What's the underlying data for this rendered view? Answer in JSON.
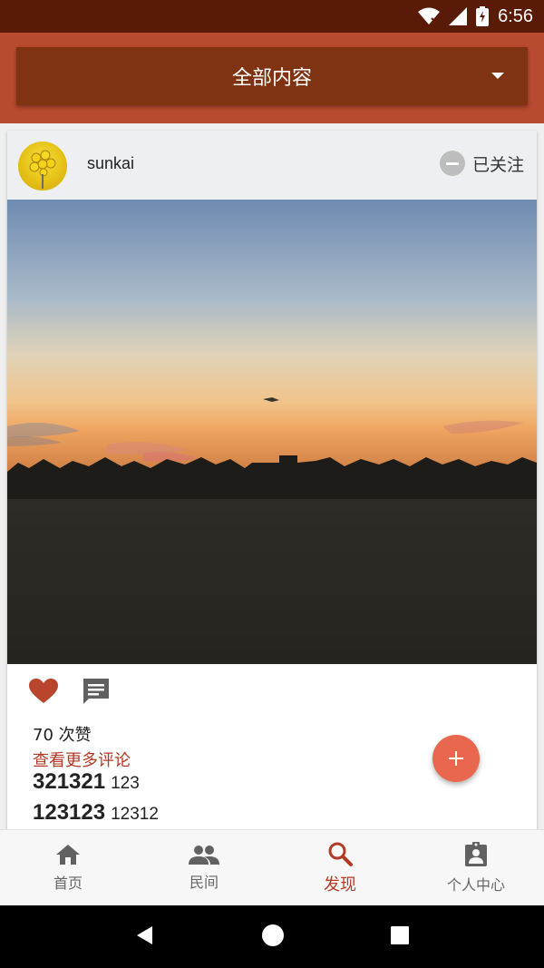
{
  "status_bar": {
    "time": "6:56",
    "icons": [
      "wifi-icon",
      "cell-signal-icon",
      "battery-icon"
    ]
  },
  "header": {
    "dropdown_label": "全部内容",
    "caret_icon": "dropdown-caret-icon"
  },
  "post": {
    "username": "sunkai",
    "avatar_icon": "avatar",
    "follow_label": "已关注",
    "follow_icon": "minus-circle-icon",
    "likes_text": "70 次赞",
    "more_comments_label": "查看更多评论",
    "comments": [
      {
        "author": "321321",
        "text": "123"
      },
      {
        "author": "123123",
        "text": "12312"
      }
    ],
    "liked": true
  },
  "fab": {
    "icon": "add-icon",
    "label": "+"
  },
  "bottom_nav": {
    "items": [
      {
        "label": "首页",
        "icon": "home-icon",
        "active": false
      },
      {
        "label": "民间",
        "icon": "people-icon",
        "active": false
      },
      {
        "label": "发现",
        "icon": "search-icon",
        "active": true
      },
      {
        "label": "个人中心",
        "icon": "profile-icon",
        "active": false
      }
    ]
  },
  "system_nav": {
    "icons": [
      "back-icon",
      "home-circle-icon",
      "recents-icon"
    ]
  },
  "colors": {
    "primary": "#b84a2f",
    "primary_dark": "#5a1a08",
    "dropdown_bg": "#7f3312",
    "accent": "#b23a26",
    "fab": "#e9674f",
    "like": "#b9452d"
  }
}
